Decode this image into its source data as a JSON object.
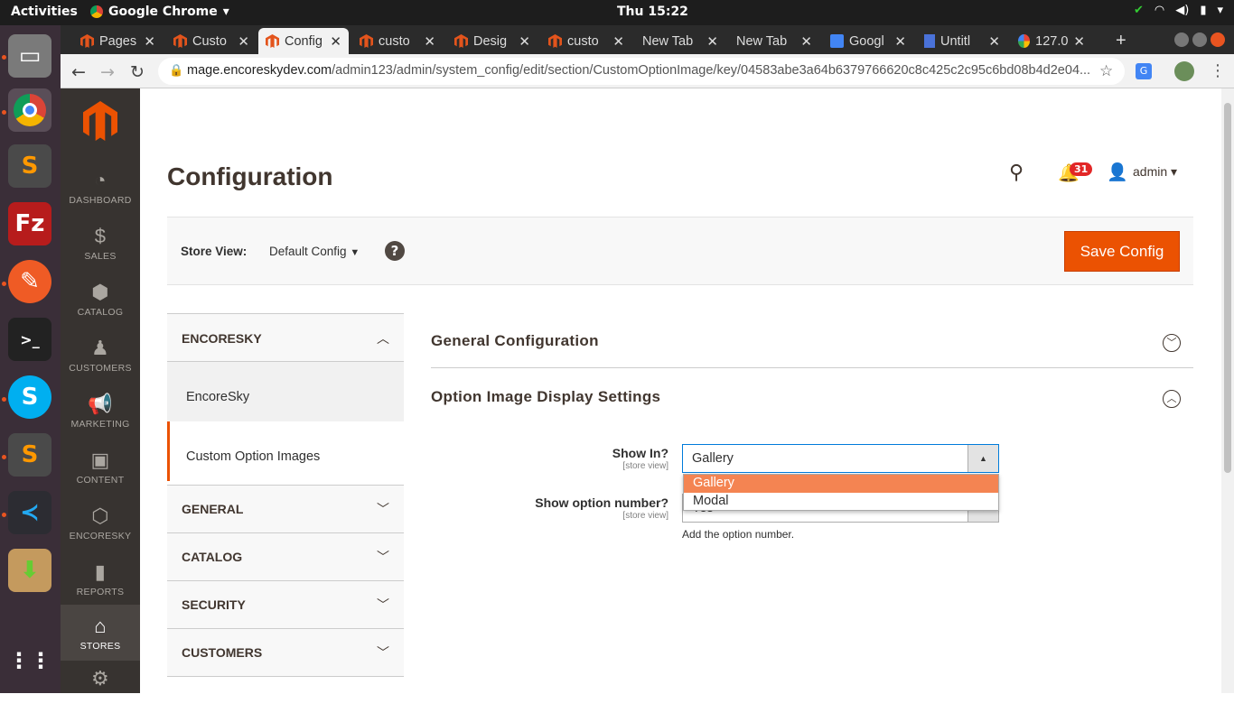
{
  "os": {
    "activities": "Activities",
    "app_name": "Google Chrome",
    "clock": "Thu 15:22"
  },
  "browser": {
    "tabs": [
      {
        "label": "Pages"
      },
      {
        "label": "Custo"
      },
      {
        "label": "Config"
      },
      {
        "label": "custo"
      },
      {
        "label": "Desig"
      },
      {
        "label": "custo"
      },
      {
        "label": "New Tab"
      },
      {
        "label": "New Tab"
      },
      {
        "label": "Googl"
      },
      {
        "label": "Untitl"
      },
      {
        "label": "127.0"
      }
    ],
    "url_host": "mage.encoreskydev.com",
    "url_path": "/admin123/admin/system_config/edit/section/CustomOptionImage/key/04583abe3a64b6379766620c8c425c2c95c6bd08b4d2e04..."
  },
  "admin_menu": {
    "items": [
      {
        "label": "DASHBOARD",
        "icon": "dashboard-icon"
      },
      {
        "label": "SALES",
        "icon": "dollar-icon"
      },
      {
        "label": "CATALOG",
        "icon": "box-icon"
      },
      {
        "label": "CUSTOMERS",
        "icon": "person-icon"
      },
      {
        "label": "MARKETING",
        "icon": "megaphone-icon"
      },
      {
        "label": "CONTENT",
        "icon": "content-icon"
      },
      {
        "label": "ENCORESKY",
        "icon": "hexagon-icon"
      },
      {
        "label": "REPORTS",
        "icon": "bar-chart-icon"
      },
      {
        "label": "STORES",
        "icon": "store-icon"
      }
    ]
  },
  "page": {
    "title": "Configuration",
    "notifications_count": "31",
    "user": "admin",
    "store_view_label": "Store View:",
    "store_view_value": "Default Config",
    "save_label": "Save Config"
  },
  "config_tabs": {
    "encoresky": "ENCORESKY",
    "encoresky_items": [
      "EncoreSky",
      "Custom Option Images"
    ],
    "general": "GENERAL",
    "catalog": "CATALOG",
    "security": "SECURITY",
    "customers": "CUSTOMERS"
  },
  "sections": {
    "general_configuration": "General Configuration",
    "display_settings": "Option Image Display Settings"
  },
  "fields": {
    "show_in_label": "Show In?",
    "show_in_scope": "[store view]",
    "show_in_value": "Gallery",
    "show_in_options": [
      "Gallery",
      "Modal"
    ],
    "show_number_label": "Show option number?",
    "show_number_scope": "[store view]",
    "show_number_value": "Yes",
    "show_number_note": "Add the option number."
  },
  "colors": {
    "accent": "#eb5202",
    "menu_bg": "#373330",
    "selected_option": "#f48452"
  }
}
